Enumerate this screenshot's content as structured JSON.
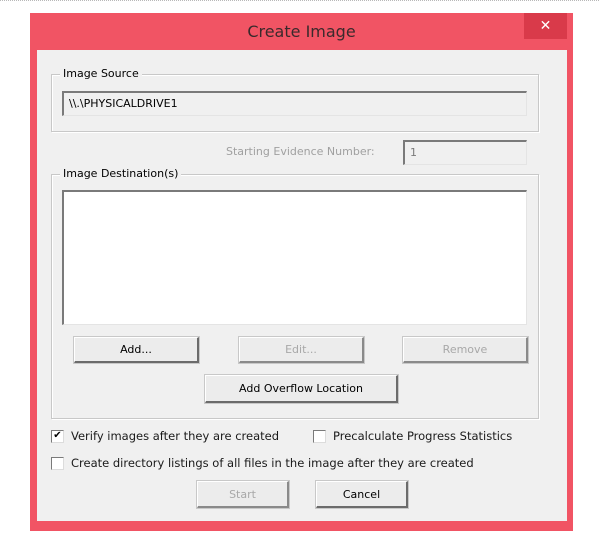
{
  "window": {
    "title": "Create Image",
    "close_glyph": "✕",
    "accent_color": "#f15464"
  },
  "image_source": {
    "group_label": "Image Source",
    "value": "\\\\.\\PHYSICALDRIVE1"
  },
  "evidence": {
    "label": "Starting Evidence Number:",
    "value": "1"
  },
  "destinations": {
    "group_label": "Image Destination(s)",
    "items": [],
    "buttons": {
      "add": "Add...",
      "edit": "Edit...",
      "remove": "Remove",
      "add_overflow": "Add Overflow Location"
    }
  },
  "options": {
    "verify": {
      "label": "Verify images after they are created",
      "checked": true,
      "check_glyph": "✔"
    },
    "precalculate": {
      "label": "Precalculate Progress Statistics",
      "checked": false
    },
    "directory_listings": {
      "label": "Create directory listings of all files in the image after they are created",
      "checked": false
    }
  },
  "footer": {
    "start": "Start",
    "cancel": "Cancel"
  }
}
